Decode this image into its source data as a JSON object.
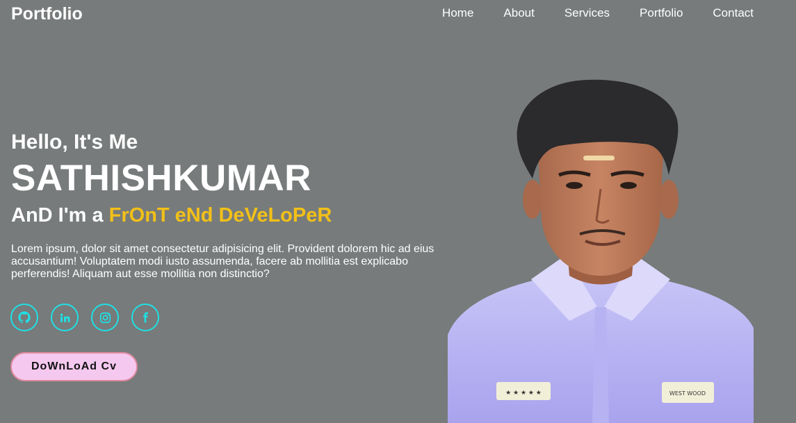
{
  "header": {
    "logo": "Portfolio",
    "nav": [
      "Home",
      "About",
      "Services",
      "Portfolio",
      "Contact"
    ]
  },
  "hero": {
    "greeting": "Hello, It's Me",
    "name": "SATHISHKUMAR",
    "role_prefix": "AnD I'm a ",
    "role_highlight": "FrOnT eNd DeVeLoPeR",
    "description": "Lorem ipsum, dolor sit amet consectetur adipisicing elit. Provident dolorem hic ad eius accusantium! Voluptatem modi iusto assumenda, facere ab mollitia est explicabo perferendis! Aliquam aut esse mollitia non distinctio?",
    "socials": [
      {
        "icon": "github-icon"
      },
      {
        "icon": "linkedin-icon"
      },
      {
        "icon": "instagram-icon"
      },
      {
        "icon": "facebook-icon"
      }
    ],
    "download_label": "DoWnLoAd Cv"
  },
  "photo": {
    "shirt_badge_left": "★ ★ ★ ★ ★",
    "shirt_badge_right": "WEST WOOD"
  },
  "colors": {
    "background": "#777b7b",
    "accent_yellow": "#f2c018",
    "accent_cyan": "#1fe0e6",
    "button_bg": "#f5c9ef",
    "button_border": "#e08aa0"
  }
}
